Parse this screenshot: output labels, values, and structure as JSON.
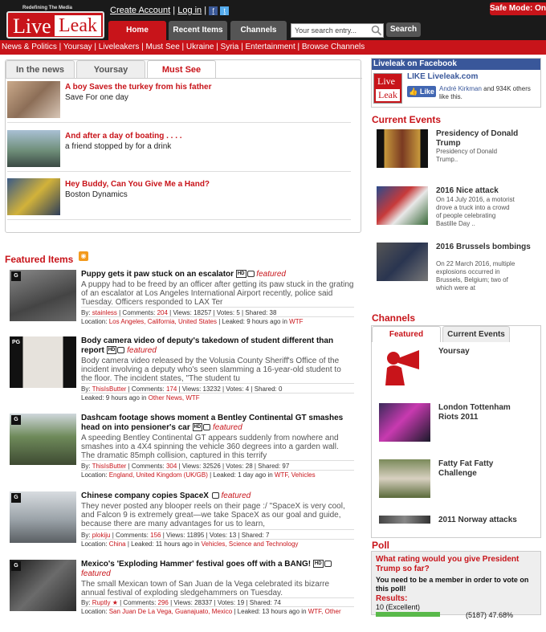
{
  "header": {
    "tagline": "Redefining The Media",
    "logo_live": "Live",
    "logo_leak": "Leak",
    "create_account": "Create Account",
    "login": "Log in",
    "safe_mode": "Safe Mode: On",
    "tabs": {
      "home": "Home",
      "recent": "Recent Items",
      "channels": "Channels"
    },
    "search": {
      "placeholder": "Your search entry...",
      "button": "Search"
    }
  },
  "nav": "News & Politics | Yoursay | Liveleakers | Must See | Ukraine | Syria | Entertainment | Browse Channels",
  "news_tabs": [
    "In the news",
    "Yoursay",
    "Must See"
  ],
  "news_items": [
    {
      "title": "A boy Saves the turkey from his father",
      "sub": "Save For one day"
    },
    {
      "title": "And after a day of boating . . . .",
      "sub": "a friend stopped by for a drink"
    },
    {
      "title": "Hey Buddy, Can You Give Me a Hand?",
      "sub": "Boston Dynamics"
    }
  ],
  "featured_heading": "Featured Items",
  "featured": [
    {
      "rating": "G",
      "title": "Puppy gets it paw stuck on an escalator",
      "featured": "featured",
      "desc": "A puppy had to be freed by an officer after getting its paw stuck in the grating of an escalator at Los Angeles International Airport recently, police said Tuesday. Officers responded to LAX Ter",
      "by": "stainless",
      "comments": "204",
      "views": "18257",
      "votes": "5",
      "shared": "38",
      "location": "Los Angeles, California, United States",
      "leaked": "9 hours ago",
      "cats": "WTF"
    },
    {
      "rating": "PG",
      "title": "Body camera video of deputy's takedown of student different than report",
      "featured": "featured",
      "desc": "Body camera video released by the Volusia County Sheriff's Office of the incident involving a deputy who's seen slamming a 16-year-old student to the floor. The incident states, \"The student tu",
      "by": "ThisIsButter",
      "comments": "174",
      "views": "13232",
      "votes": "4",
      "shared": "0",
      "leaked": "9 hours ago",
      "cats": "Other News, WTF"
    },
    {
      "rating": "G",
      "title": "Dashcam footage shows moment a Bentley Continental GT smashes head on into pensioner's car",
      "featured": "featured",
      "desc": "A speeding Bentley Continental GT appears suddenly from nowhere and smashes into a 4X4 spinning the vehicle 360 degrees into a garden wall. The dramatic 85mph collision, captured in this terrify",
      "by": "ThisIsButter",
      "comments": "304",
      "views": "32526",
      "votes": "28",
      "shared": "97",
      "location": "England, United Kingdom (UK/GB)",
      "leaked": "1 day ago",
      "cats": "WTF, Vehicles"
    },
    {
      "rating": "G",
      "title": "Chinese company copies SpaceX",
      "featured": "featured",
      "desc": "They never posted any blooper reels on their page :/ \"SpaceX is very cool, and Falcon 9 is extremely great—we take SpaceX as our goal and guide, because there are many advantages for us to learn,",
      "by": "plokiju",
      "comments": "156",
      "views": "11895",
      "votes": "13",
      "shared": "7",
      "location": "China",
      "leaked": "11 hours ago",
      "cats": "Vehicles, Science and Technology"
    },
    {
      "rating": "G",
      "title": "Mexico's 'Exploding Hammer' festival goes off with a BANG!",
      "featured": "featured",
      "desc": "The small Mexican town of San Juan de la Vega celebrated its bizarre annual festival of exploding sledgehammers on Tuesday.",
      "by": "Ruptly",
      "comments": "296",
      "views": "28337",
      "votes": "19",
      "shared": "74",
      "location": "San Juan De La Vega, Guanajuato, Mexico",
      "leaked": "13 hours ago",
      "cats": "WTF, Other"
    }
  ],
  "facebook": {
    "heading": "Liveleak on Facebook",
    "like_text": "LIKE Liveleak.com",
    "button": "Like",
    "others_name": "André Kirkman",
    "others_rest": " and 934K others like this."
  },
  "current_events_heading": "Current Events",
  "current_events": [
    {
      "title": "Presidency of Donald Trump",
      "desc": "Presidency of Donald Trump.."
    },
    {
      "title": "2016 Nice attack",
      "desc": "On 14 July 2016, a motorist drove a truck into a crowd of people celebrating Bastille Day .."
    },
    {
      "title": "2016 Brussels bombings",
      "desc": "On 22 March 2016, multiple explosions occurred in Brussels, Belgium; two of which were at"
    }
  ],
  "channels_heading": "Channels",
  "channel_tabs": [
    "Featured",
    "Current Events"
  ],
  "channels": [
    "Yoursay",
    "London Tottenham Riots 2011",
    "Fatty Fat Fatty Challenge",
    "2011 Norway attacks"
  ],
  "poll": {
    "heading": "Poll",
    "question": "What rating would you give President Trump so far?",
    "member": "You need to be a member in order to vote on this poll!",
    "results": "Results:",
    "option": "10 (Excellent)",
    "count": "(5187) 47.68%",
    "fraction": 0.4768
  },
  "colors": {
    "brand_red": "#c8141a",
    "facebook_blue": "#39579a"
  }
}
